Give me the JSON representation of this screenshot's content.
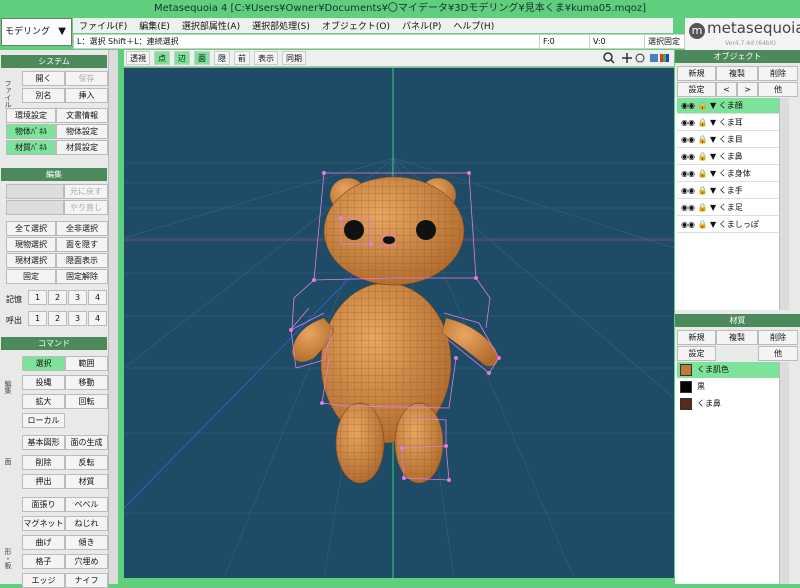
{
  "window": {
    "title": "Metasequoia 4 [C:¥Users¥Owner¥Documents¥〇マイデータ¥3Dモデリング¥見本くま¥kuma05.mqoz]"
  },
  "mode": {
    "label": "モデリング"
  },
  "menu": [
    "ファイル(F)",
    "編集(E)",
    "選択部属性(A)",
    "選択部処理(S)",
    "オブジェクト(O)",
    "パネル(P)",
    "ヘルプ(H)"
  ],
  "status": {
    "hint": "L：選択  Shift＋L：連続選択",
    "f": "F:0",
    "v": "V:0",
    "fixed": "選択固定"
  },
  "logo": {
    "text": "metasequoia",
    "num": "4",
    "version": "Ver4.7.4d (64bit)"
  },
  "system": {
    "title": "システム",
    "side": "ファイル",
    "open": "開く",
    "save": "保存",
    "saveas": "別名",
    "insert": "挿入",
    "env": "環境設定",
    "docinfo": "文書情報",
    "objpanel": "物体ﾊﾟﾈﾙ",
    "objset": "物体設定",
    "matpanel": "材質ﾊﾟﾈﾙ",
    "matset": "材質設定"
  },
  "edit": {
    "title": "編集",
    "undo": "元に戻す",
    "redo": "やり直し",
    "selall": "全て選択",
    "deselall": "全非選択",
    "hidesel": "現物選択",
    "hidefaces": "面を隠す",
    "matsel": "現材選択",
    "showhidden": "隠面表示",
    "fix": "固定",
    "unfix": "固定解除",
    "mem": "記憶",
    "call": "呼出",
    "n1": "1",
    "n2": "2",
    "n3": "3",
    "n4": "4"
  },
  "command": {
    "title": "コマンド",
    "g1": "編集",
    "g2": "面",
    "g3": "形・板",
    "select": "選択",
    "range": "範囲",
    "lasso": "投縄",
    "move": "移動",
    "scale": "拡大",
    "rotate": "回転",
    "local": "ローカル",
    "basic": "基本図形",
    "facegen": "面の生成",
    "delete": "削除",
    "flip": "反転",
    "extrude": "押出",
    "material": "材質",
    "stretch": "面張り",
    "bevel": "ベベル",
    "magnet": "マグネット",
    "twist": "ねじれ",
    "bend": "曲げ",
    "tilt": "傾き",
    "lattice": "格子",
    "hole": "穴埋め",
    "knife": "ナイフ",
    "edge": "エッジ"
  },
  "viewtb": {
    "persp": "透視",
    "point": "点",
    "edge": "辺",
    "face": "面",
    "hide": "隠",
    "front": "前",
    "display": "表示",
    "sync": "同期"
  },
  "objects": {
    "title": "オブジェクト",
    "new": "新規",
    "copy": "複製",
    "del": "削除",
    "setting": "設定",
    "other": "他",
    "up": "<",
    "down": ">",
    "items": [
      "くま顔",
      "くま耳",
      "くま目",
      "くま鼻",
      "くま身体",
      "くま手",
      "くま足",
      "くましっぽ"
    ]
  },
  "materials": {
    "title": "材質",
    "new": "新規",
    "copy": "複製",
    "del": "削除",
    "setting": "設定",
    "other": "他",
    "items": [
      {
        "name": "くま肌色",
        "color": "#c17a35"
      },
      {
        "name": "黒",
        "color": "#000000"
      },
      {
        "name": "くま鼻",
        "color": "#5a2a1c"
      }
    ]
  },
  "colors": {
    "accent": "#5fcf7e",
    "active": "#7de39a",
    "header": "#4c8a5c",
    "viewport": "#1e4b66",
    "bear": "#d38a45"
  }
}
